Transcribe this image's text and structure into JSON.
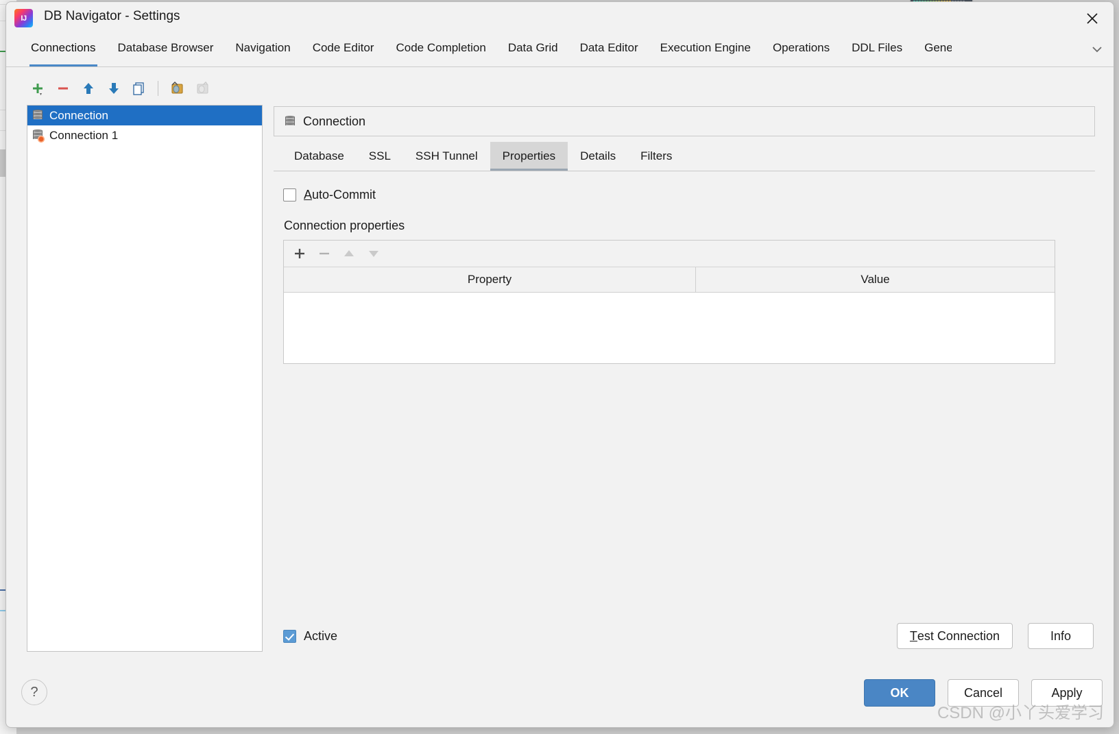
{
  "window": {
    "title": "DB Navigator - Settings",
    "app_icon": "intellij-idea-icon",
    "close_icon": "close-icon"
  },
  "top_tabs": {
    "items": [
      {
        "label": "Connections",
        "active": true
      },
      {
        "label": "Database Browser",
        "active": false
      },
      {
        "label": "Navigation",
        "active": false
      },
      {
        "label": "Code Editor",
        "active": false
      },
      {
        "label": "Code Completion",
        "active": false
      },
      {
        "label": "Data Grid",
        "active": false
      },
      {
        "label": "Data Editor",
        "active": false
      },
      {
        "label": "Execution Engine",
        "active": false
      },
      {
        "label": "Operations",
        "active": false
      },
      {
        "label": "DDL Files",
        "active": false
      },
      {
        "label": "Gene",
        "active": false
      }
    ],
    "overflow_icon": "chevron-down-icon"
  },
  "toolbar": {
    "buttons": [
      {
        "name": "add-connection-button",
        "icon": "plus-icon",
        "enabled": true
      },
      {
        "name": "remove-connection-button",
        "icon": "minus-icon",
        "enabled": true
      },
      {
        "name": "move-up-button",
        "icon": "arrow-up-icon",
        "enabled": true
      },
      {
        "name": "move-down-button",
        "icon": "arrow-down-icon",
        "enabled": true
      },
      {
        "name": "duplicate-button",
        "icon": "copy-icon",
        "enabled": true
      },
      {
        "name": "copy-connection-button",
        "icon": "copy-database-icon",
        "enabled": true
      },
      {
        "name": "paste-connection-button",
        "icon": "paste-database-icon",
        "enabled": false
      }
    ]
  },
  "connection_list": {
    "items": [
      {
        "label": "Connection",
        "icon": "database-icon",
        "selected": true
      },
      {
        "label": "Connection 1",
        "icon": "database-configure-icon",
        "selected": false
      }
    ]
  },
  "pane": {
    "header_title": "Connection",
    "header_icon": "database-icon",
    "tabs": [
      {
        "label": "Database",
        "active": false
      },
      {
        "label": "SSL",
        "active": false
      },
      {
        "label": "SSH Tunnel",
        "active": false
      },
      {
        "label": "Properties",
        "active": true
      },
      {
        "label": "Details",
        "active": false
      },
      {
        "label": "Filters",
        "active": false
      }
    ]
  },
  "properties_tab": {
    "auto_commit": {
      "label": "Auto-Commit",
      "mnemonic": "A",
      "checked": false
    },
    "section_label": "Connection properties",
    "table_toolbar": [
      {
        "name": "add-property-button",
        "icon": "plus-icon",
        "enabled": true
      },
      {
        "name": "remove-property-button",
        "icon": "minus-icon",
        "enabled": false
      },
      {
        "name": "move-property-up-button",
        "icon": "triangle-up-icon",
        "enabled": false
      },
      {
        "name": "move-property-down-button",
        "icon": "triangle-down-icon",
        "enabled": false
      }
    ],
    "table": {
      "columns": [
        "Property",
        "Value"
      ],
      "rows": []
    }
  },
  "pane_bottom": {
    "active": {
      "label": "Active",
      "checked": true
    },
    "test_connection": {
      "label": "Test Connection",
      "mnemonic": "T"
    },
    "info": {
      "label": "Info"
    }
  },
  "footer": {
    "help_label": "?",
    "ok": "OK",
    "cancel": "Cancel",
    "apply": "Apply"
  },
  "watermark": "CSDN @小丫头爱学习",
  "colors": {
    "accent": "#4a88c7",
    "selection": "#1f6fc4",
    "primary_button": "#4a86c5",
    "window_bg": "#f2f2f2",
    "checkbox_checked": "#5b9bd5"
  }
}
